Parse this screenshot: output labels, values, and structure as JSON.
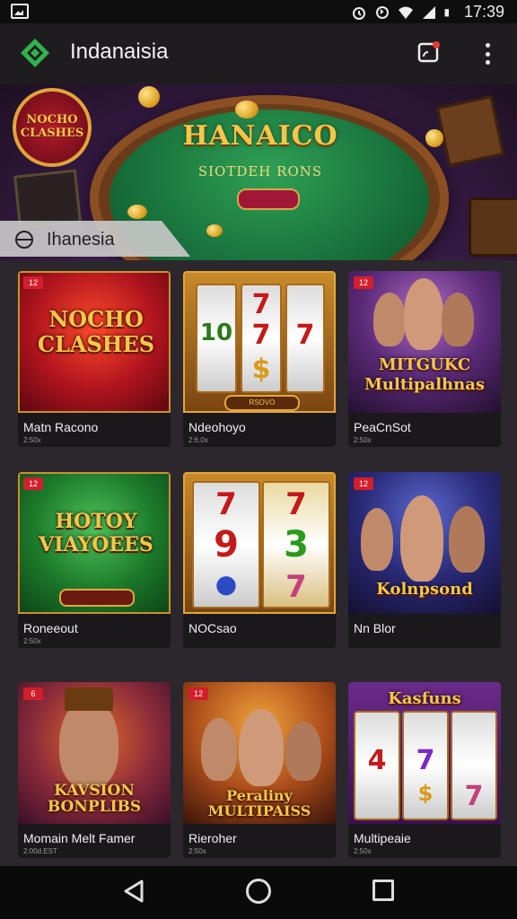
{
  "status_bar": {
    "time": "17:39",
    "icons": [
      "image-icon",
      "alarm-icon",
      "sync-icon",
      "wifi-icon",
      "signal-icon",
      "battery-icon"
    ]
  },
  "app_bar": {
    "title": "Indanaisia"
  },
  "banner": {
    "title": "HANAICO",
    "subtitle": "SIOTDEH RONS",
    "badge_text": "NOCHO CLASHES",
    "label": "Ihanesia"
  },
  "cards": [
    {
      "badge": "12",
      "art_text": "NOCHO CLASHES",
      "title": "Matn Racono",
      "meta": "2:50x"
    },
    {
      "badge": "",
      "art_text": "RSOVO",
      "title": "Ndeohoyo",
      "meta": "2:6.0x"
    },
    {
      "badge": "12",
      "art_text": "MITGUKC Multipalhnas",
      "title": "PeaCnSot",
      "meta": "2:50x"
    },
    {
      "badge": "12",
      "art_text": "HOTOY VIAYOEES",
      "title": "Roneeout",
      "meta": "2:50x"
    },
    {
      "badge": "",
      "art_text": "",
      "title": "NOCsao",
      "meta": ""
    },
    {
      "badge": "12",
      "art_text": "Kolnpsond",
      "title": "Nn Blor",
      "meta": ""
    },
    {
      "badge": "6",
      "art_text": "KAVSION BONPLIBS",
      "title": "Momain Melt Famer",
      "meta": "2:00d.EST"
    },
    {
      "badge": "12",
      "art_text": "Peraliny MULTIPAISS",
      "title": "Rieroher",
      "meta": "2:50x"
    },
    {
      "badge": "",
      "art_text": "Kasfuns",
      "title": "Multipeaie",
      "meta": "2:50x"
    }
  ],
  "colors": {
    "accent": "#f6c64b",
    "badge": "#d21f2b",
    "background": "#2b272c",
    "app_bar": "#1f1c20"
  }
}
